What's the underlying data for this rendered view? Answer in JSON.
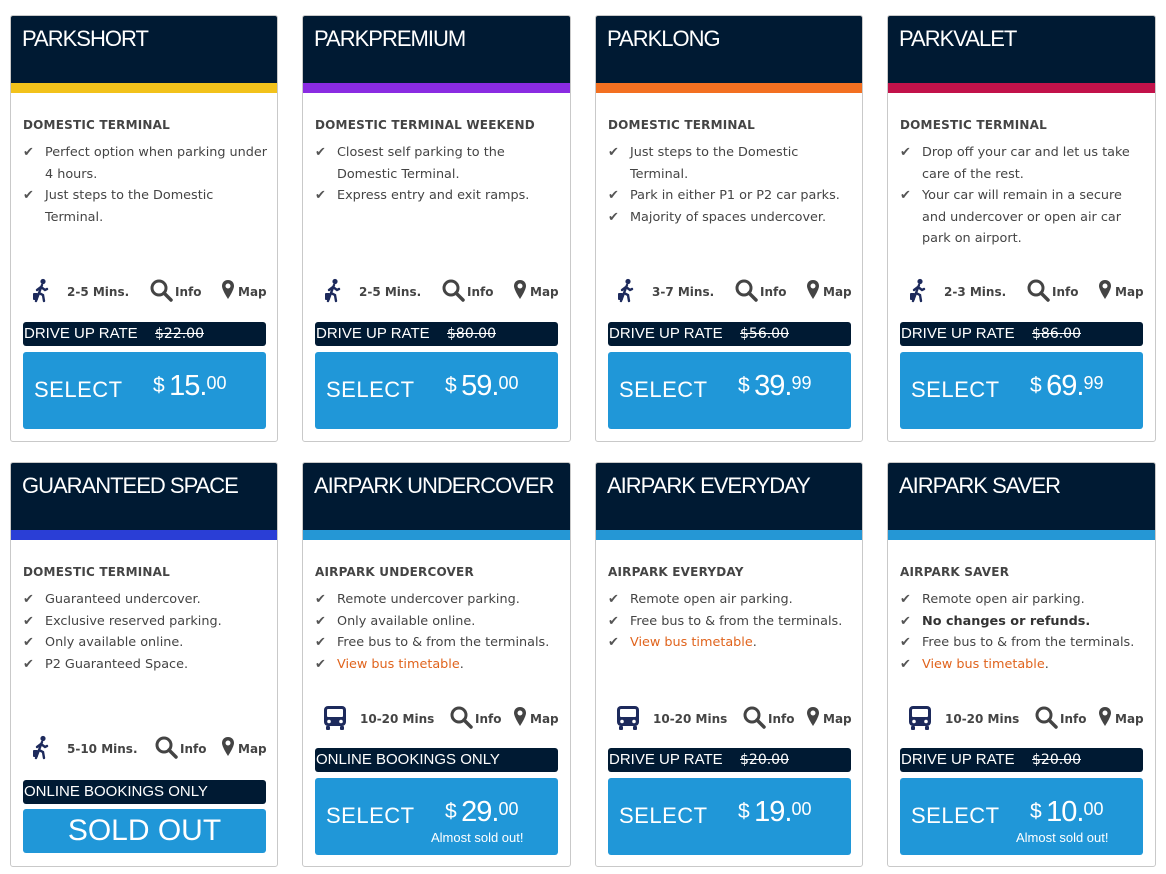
{
  "colors": {
    "header_bg": "#001a33",
    "select_blue": "#2097d8",
    "link_orange": "#e0631c",
    "bar_short": "#f2c21b",
    "bar_premium": "#8a2be2",
    "bar_long": "#f37021",
    "bar_valet": "#c2124a",
    "bar_guaranteed": "#2a3ed6",
    "bar_airpark": "#2597d5"
  },
  "cards": [
    {
      "title": "PARKSHORT",
      "subtitle": "DOMESTIC TERMINAL",
      "features": [
        {
          "text": "Perfect option when parking under 4 hours."
        },
        {
          "text": "Just steps to the Domestic Terminal."
        }
      ],
      "transit_icon": "walking-person-icon",
      "time": "2-5 Mins.",
      "info_label": "Info",
      "map_label": "Map",
      "rate_label": "DRIVE UP RATE",
      "rate_old": "$22.00",
      "select_label": "SELECT",
      "price_dollar": "$",
      "price_whole": "15.",
      "price_cents": "00"
    },
    {
      "title": "PARKPREMIUM",
      "subtitle": "DOMESTIC TERMINAL WEEKEND",
      "features": [
        {
          "text": "Closest self parking to the Domestic Terminal."
        },
        {
          "text": "Express entry and exit ramps."
        }
      ],
      "transit_icon": "walking-person-icon",
      "time": "2-5 Mins.",
      "info_label": "Info",
      "map_label": "Map",
      "rate_label": "DRIVE UP RATE",
      "rate_old": "$80.00",
      "select_label": "SELECT",
      "price_dollar": "$",
      "price_whole": "59.",
      "price_cents": "00"
    },
    {
      "title": "PARKLONG",
      "subtitle": "DOMESTIC TERMINAL",
      "features": [
        {
          "text": "Just steps to the Domestic Terminal."
        },
        {
          "text": "Park in either P1 or P2 car parks."
        },
        {
          "text": "Majority of spaces undercover."
        }
      ],
      "transit_icon": "walking-person-icon",
      "time": "3-7 Mins.",
      "info_label": "Info",
      "map_label": "Map",
      "rate_label": "DRIVE UP RATE",
      "rate_old": "$56.00",
      "select_label": "SELECT",
      "price_dollar": "$",
      "price_whole": "39.",
      "price_cents": "99"
    },
    {
      "title": "PARKVALET",
      "subtitle": "DOMESTIC TERMINAL",
      "features": [
        {
          "text": "Drop off your car and let us take care of the rest."
        },
        {
          "text": "Your car will remain in a secure and undercover or open air car park on airport."
        }
      ],
      "transit_icon": "walking-person-icon",
      "time": "2-3 Mins.",
      "info_label": "Info",
      "map_label": "Map",
      "rate_label": "DRIVE UP RATE",
      "rate_old": "$86.00",
      "select_label": "SELECT",
      "price_dollar": "$",
      "price_whole": "69.",
      "price_cents": "99"
    },
    {
      "title": "GUARANTEED SPACE",
      "subtitle": "DOMESTIC TERMINAL",
      "features": [
        {
          "text": "Guaranteed undercover."
        },
        {
          "text": "Exclusive reserved parking."
        },
        {
          "text": "Only available online."
        },
        {
          "text": "P2 Guaranteed Space."
        }
      ],
      "transit_icon": "walking-person-icon",
      "time": "5-10 Mins.",
      "info_label": "Info",
      "map_label": "Map",
      "rate_label": "ONLINE BOOKINGS ONLY",
      "sold_out_label": "SOLD OUT"
    },
    {
      "title": "AIRPARK UNDERCOVER",
      "subtitle": "AIRPARK UNDERCOVER",
      "features": [
        {
          "text": "Remote undercover parking."
        },
        {
          "text": "Only available online."
        },
        {
          "text": "Free bus to & from the terminals."
        },
        {
          "text": "View bus timetable",
          "tail": "."
        }
      ],
      "transit_icon": "bus-icon",
      "time": "10-20 Mins",
      "info_label": "Info",
      "map_label": "Map",
      "rate_label": "ONLINE BOOKINGS ONLY",
      "select_label": "SELECT",
      "price_dollar": "$",
      "price_whole": "29.",
      "price_cents": "00",
      "note": "Almost sold out!"
    },
    {
      "title": "AIRPARK EVERYDAY",
      "subtitle": "AIRPARK EVERYDAY",
      "features": [
        {
          "text": "Remote open air parking."
        },
        {
          "text": "Free bus to & from the terminals."
        },
        {
          "text": "View bus timetable",
          "tail": "."
        }
      ],
      "transit_icon": "bus-icon",
      "time": "10-20 Mins",
      "info_label": "Info",
      "map_label": "Map",
      "rate_label": "DRIVE UP RATE",
      "rate_old": "$20.00",
      "select_label": "SELECT",
      "price_dollar": "$",
      "price_whole": "19.",
      "price_cents": "00"
    },
    {
      "title": "AIRPARK SAVER",
      "subtitle": "AIRPARK SAVER",
      "features": [
        {
          "text": "Remote open air parking."
        },
        {
          "text": "No changes or refunds."
        },
        {
          "text": "Free bus to & from the terminals."
        },
        {
          "text": "View bus timetable",
          "tail": "."
        }
      ],
      "transit_icon": "bus-icon",
      "time": "10-20 Mins",
      "info_label": "Info",
      "map_label": "Map",
      "rate_label": "DRIVE UP RATE",
      "rate_old": "$20.00",
      "select_label": "SELECT",
      "price_dollar": "$",
      "price_whole": "10.",
      "price_cents": "00",
      "note": "Almost sold out!"
    }
  ]
}
